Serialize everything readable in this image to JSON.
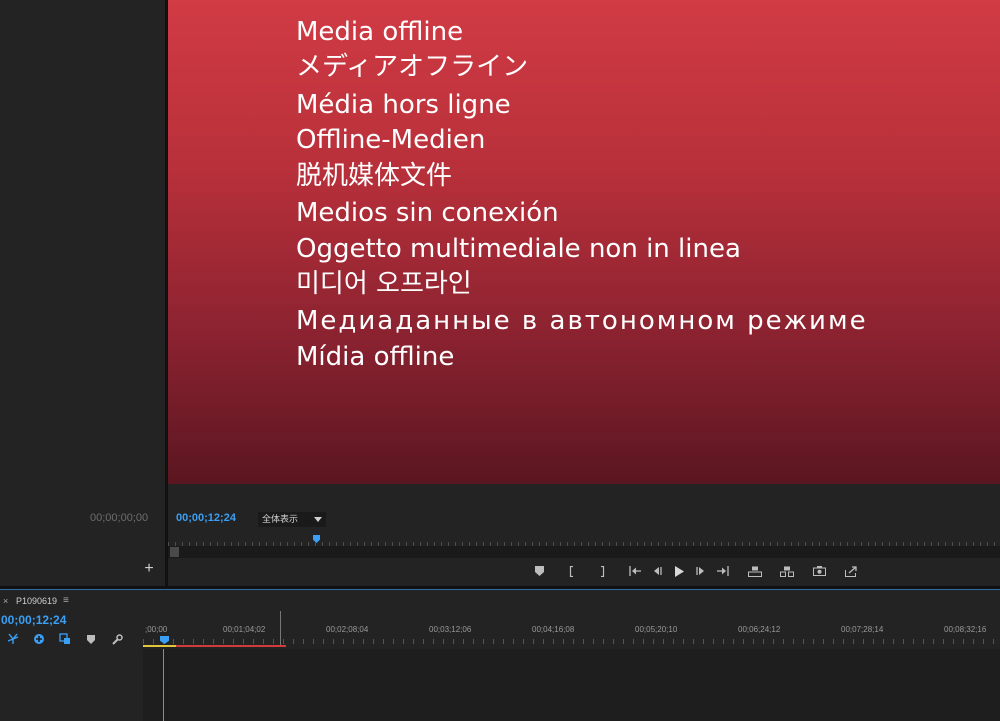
{
  "source_monitor": {
    "timecode": "00;00;00;00",
    "add_button": "+"
  },
  "program_monitor": {
    "offline_messages": [
      "Media offline",
      "メディアオフライン",
      "Média hors ligne",
      "Offline-Medien",
      "脱机媒体文件",
      "Medios sin conexión",
      "Oggetto multimediale non in linea",
      "미디어 오프라인",
      "Медиаданные в автономном режиме",
      "Mídia offline"
    ],
    "timecode": "00;00;12;24",
    "fit_label": "全体表示",
    "transport_buttons": [
      "add-marker",
      "mark-in",
      "mark-out",
      "go-to-in",
      "step-back",
      "play",
      "step-forward",
      "go-to-out",
      "lift",
      "extract",
      "export-frame",
      "button-editor"
    ]
  },
  "timeline": {
    "close_label": "×",
    "sequence_name": "P1090619",
    "menu_label": "≡",
    "timecode": "00;00;12;24",
    "tools": [
      "snap-icon",
      "linked-selection-icon",
      "add-marker-icon",
      "marker-icon",
      "wrench-icon"
    ],
    "ruler_labels": [
      ";00;00",
      "00;01;04;02",
      "00;02;08;04",
      "00;03;12;06",
      "00;04;16;08",
      "00;05;20;10",
      "00;06;24;12",
      "00;07;28;14",
      "00;08;32;16"
    ]
  },
  "colors": {
    "accent": "#3a9ff5",
    "offline_red": "#d13b44",
    "work_area_yellow": "#e2c53a",
    "work_area_red": "#d33a3a"
  }
}
